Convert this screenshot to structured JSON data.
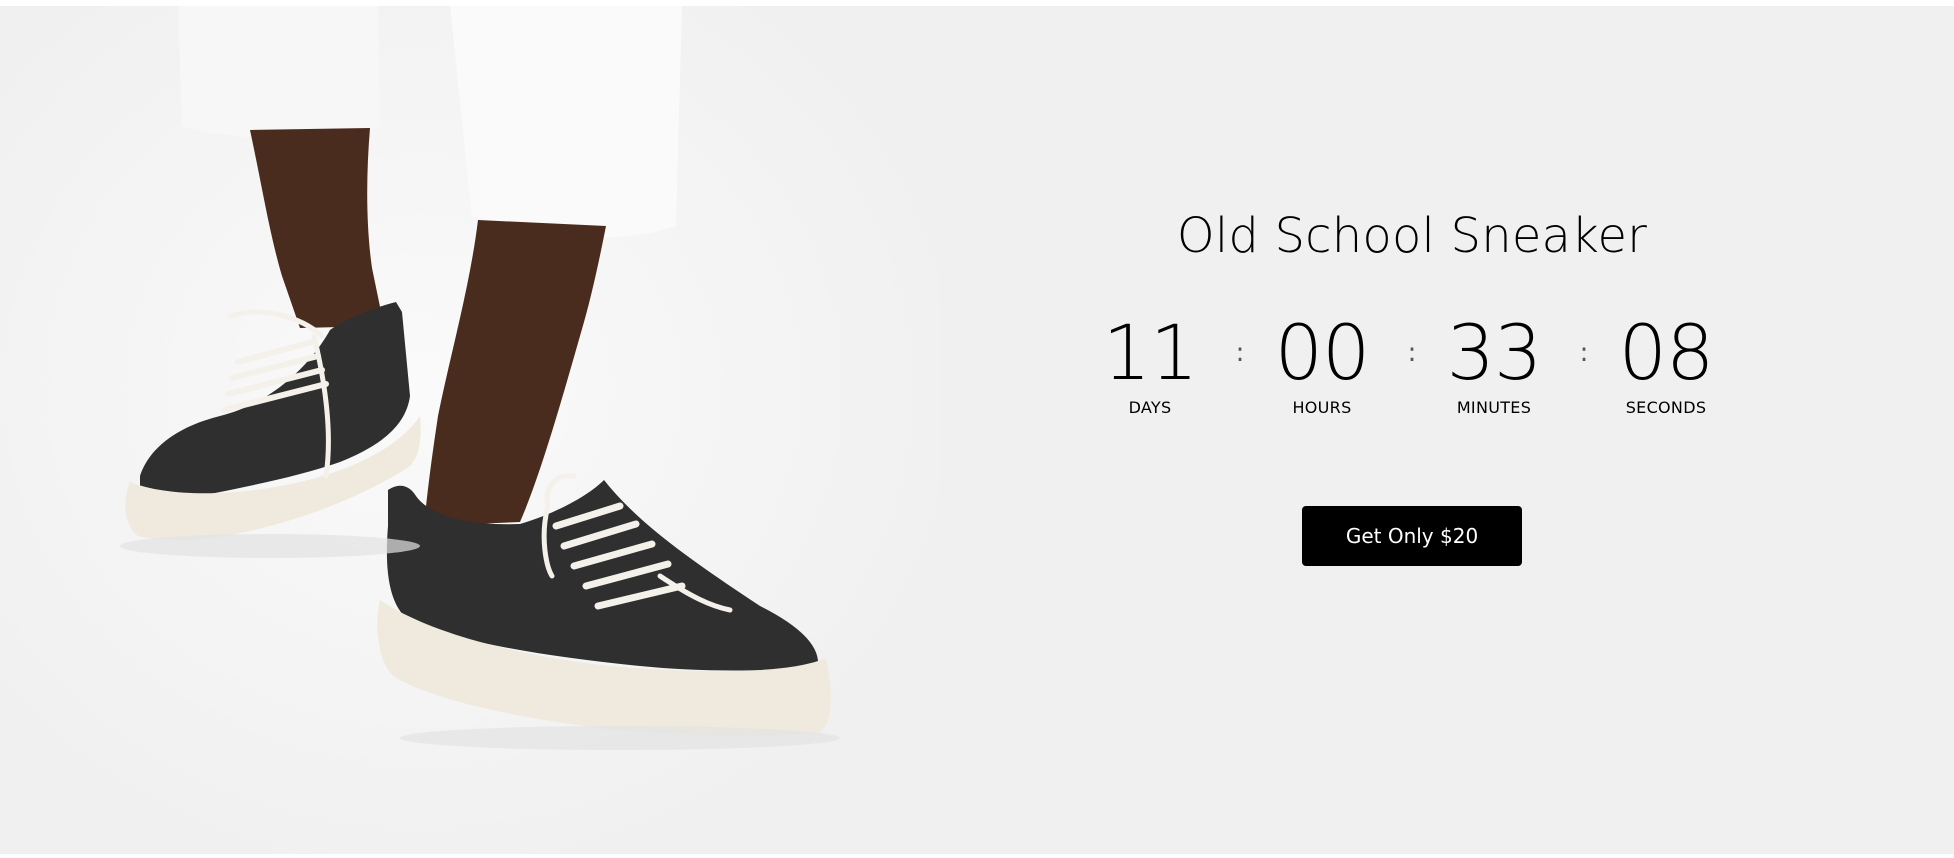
{
  "product": {
    "title": "Old School Sneaker",
    "image_subject": "sneakers-photo"
  },
  "countdown": {
    "units": [
      {
        "value": "11",
        "label": "DAYS"
      },
      {
        "value": "00",
        "label": "HOURS"
      },
      {
        "value": "33",
        "label": "MINUTES"
      },
      {
        "value": "08",
        "label": "SECONDS"
      }
    ],
    "separator": ":"
  },
  "cta": {
    "label": "Get Only $20"
  },
  "colors": {
    "background": "#f0f0f0",
    "button": "#000000",
    "button_text": "#ffffff",
    "text": "#000000"
  }
}
